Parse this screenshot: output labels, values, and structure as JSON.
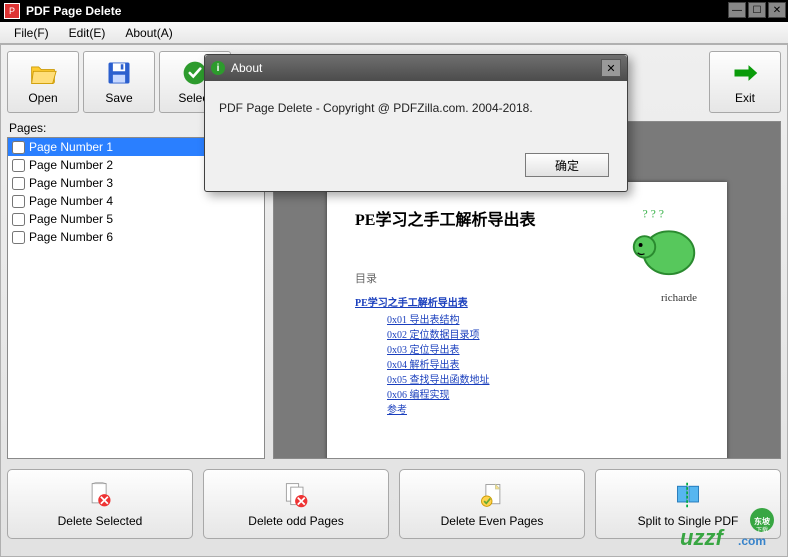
{
  "window": {
    "title": "PDF Page Delete"
  },
  "menu": {
    "file": "File(F)",
    "edit": "Edit(E)",
    "about": "About(A)"
  },
  "toolbar": {
    "open_label": "Open",
    "save_label": "Save",
    "select_label": "Select",
    "exit_label": "Exit"
  },
  "pages": {
    "label": "Pages:",
    "items": [
      {
        "label": "Page Number 1",
        "selected": true
      },
      {
        "label": "Page Number 2",
        "selected": false
      },
      {
        "label": "Page Number 3",
        "selected": false
      },
      {
        "label": "Page Number 4",
        "selected": false
      },
      {
        "label": "Page Number 5",
        "selected": false
      },
      {
        "label": "Page Number 6",
        "selected": false
      }
    ]
  },
  "preview": {
    "title": "PE学习之手工解析导出表",
    "author": "richarde",
    "toc_label": "目录",
    "toc_title": "PE学习之手工解析导出表",
    "toc_items": [
      "0x01 导出表结构",
      "0x02 定位数据目录项",
      "0x03 定位导出表",
      "0x04 解析导出表",
      "0x05 查找导出函数地址",
      "0x06 编程实现",
      "参考"
    ]
  },
  "bottom": {
    "delete_selected": "Delete Selected",
    "delete_odd": "Delete odd Pages",
    "delete_even": "Delete Even Pages",
    "split": "Split to Single PDF"
  },
  "about": {
    "title": "About",
    "text": "PDF Page Delete - Copyright @ PDFZilla.com. 2004-2018.",
    "ok": "确定"
  },
  "watermark": {
    "site": "uzzf",
    "domain": ".com",
    "tag": "东坡下载"
  }
}
